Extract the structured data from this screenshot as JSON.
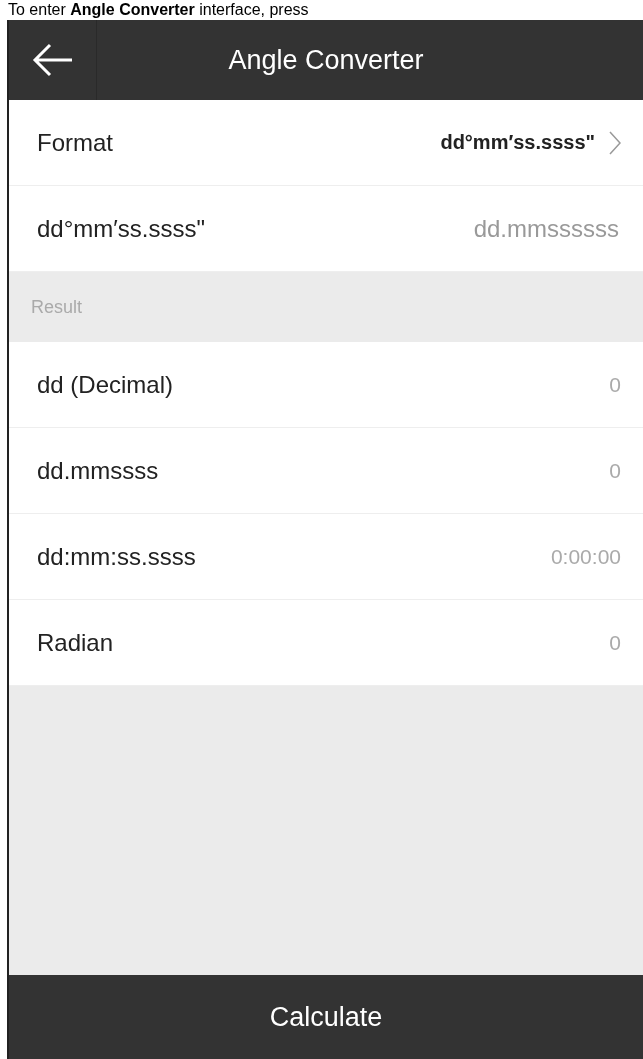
{
  "caption": "To enter **Angle Converter** interface, press",
  "header": {
    "title": "Angle Converter"
  },
  "format": {
    "label": "Format",
    "value": "dd°mm′ss.ssss\""
  },
  "input": {
    "label": "dd°mm′ss.ssss\"",
    "placeholder": "dd.mmssssss"
  },
  "result_section": {
    "title": "Result"
  },
  "results": [
    {
      "label": "dd (Decimal)",
      "value": "0"
    },
    {
      "label": "dd.mmssss",
      "value": "0"
    },
    {
      "label": "dd:mm:ss.ssss",
      "value": "0:00:00"
    },
    {
      "label": "Radian",
      "value": "0"
    }
  ],
  "calculate_button": "Calculate"
}
